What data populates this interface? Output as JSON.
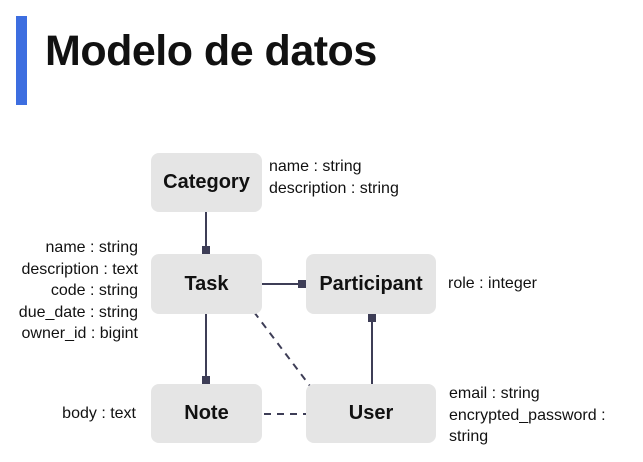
{
  "title": "Modelo de datos",
  "accent_color": "#3d6ee0",
  "entities": {
    "category": {
      "name": "Category",
      "attributes": [
        "name :  string",
        "description : string"
      ]
    },
    "task": {
      "name": "Task",
      "attributes": [
        "name : string",
        "description : text",
        "code : string",
        "due_date : string",
        "owner_id : bigint"
      ]
    },
    "participant": {
      "name": "Participant",
      "attributes": [
        "role : integer"
      ]
    },
    "note": {
      "name": "Note",
      "attributes": [
        "body : text"
      ]
    },
    "user": {
      "name": "User",
      "attributes": [
        "email : string",
        "encrypted_password :",
        "string"
      ]
    }
  }
}
